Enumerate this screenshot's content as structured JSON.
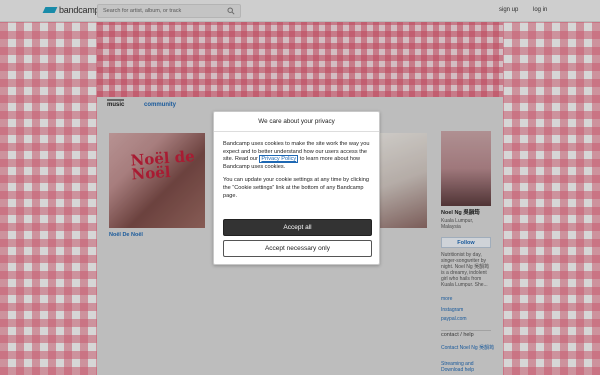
{
  "header": {
    "logo_text": "bandcamp",
    "search_placeholder": "Search for artist, album, or track",
    "signup_label": "sign up",
    "login_label": "log in"
  },
  "tabs": [
    {
      "label": "music"
    },
    {
      "label": "community"
    }
  ],
  "album": {
    "art_title": "Noël de Noël",
    "caption": "Noël De Noël"
  },
  "artist": {
    "name": "Noel Ng 吳韻筠",
    "location": "Kuala Lumpur, Malaysia",
    "follow_label": "Follow",
    "bio": "Nutritionist by day, singer-songwriter by night. Noel Ng 吳韻筠 is a dreamy, indolent girl who hails from Kuala Lumpur. She...",
    "more_label": "more",
    "links": [
      "Instagram",
      "paypal.com"
    ],
    "contact_heading": "contact / help",
    "contact_link": "Contact Noel Ng 吳韻筠",
    "streaming_link": "Streaming and Download help"
  },
  "cookie_modal": {
    "title": "We care about your privacy",
    "para1_before": "Bandcamp uses cookies to make the site work the way you expect and to better understand how our users access the site. Read our ",
    "privacy_link": "Privacy Policy",
    "para1_after": " to learn more about how Bandcamp uses cookies.",
    "para2": "You can update your cookie settings at any time by clicking the “Cookie settings” link at the bottom of any Bandcamp page.",
    "accept_all_label": "Accept all",
    "accept_necessary_label": "Accept necessary only"
  },
  "colors": {
    "accent": "#1e68b3",
    "brand": "#1da0c3",
    "gingham": "#e46980"
  }
}
